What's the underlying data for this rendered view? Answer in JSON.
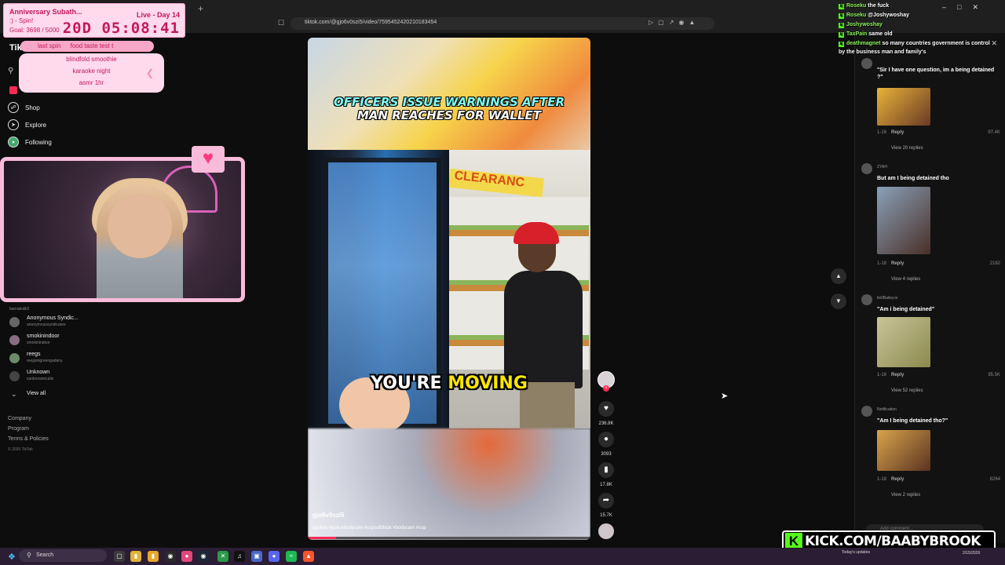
{
  "browser": {
    "url": "tiktok.com/@gjo6v0szi5/video/7595452420210183454",
    "new_tab": "+"
  },
  "subathon": {
    "title": "Anniversary Subath...",
    "status": "Live - Day 14",
    "spin": ":) - Spin!",
    "goal": "Goal: 3698 / 5000",
    "timer": "20D 05:08:41"
  },
  "spin_wheel": {
    "current": "last spin",
    "current_value": "food taste test t",
    "items": [
      "blindfold smoothie",
      "karaoke night",
      "asmr 1hr"
    ]
  },
  "tiktok": {
    "logo": "TikTok",
    "nav": [
      {
        "label": "Shop",
        "icon": "shop-icon"
      },
      {
        "label": "Explore",
        "icon": "compass-icon"
      },
      {
        "label": "Following",
        "icon": "following-icon"
      }
    ],
    "following": [
      {
        "name": "",
        "handle": "bamabolili2"
      },
      {
        "name": "Anonymous Syndic...",
        "handle": "anonymoussyndicatee"
      },
      {
        "name": "smokinindoor",
        "handle": "smokinindoor"
      },
      {
        "name": "reegs",
        "handle": "reegsingreengadany"
      },
      {
        "name": "Unknown",
        "handle": "xunknownrcalix"
      }
    ],
    "view_all": "View all",
    "footer": [
      "Company",
      "Program",
      "Terms & Policies"
    ],
    "copyright": "© 2026 TikTok"
  },
  "video": {
    "headline_line1": "OFFICERS ISSUE WARNINGS AFTER",
    "headline_line2": "MAN REACHES FOR WALLET",
    "sign_text": "CLEARANC",
    "subtitle_white": "YOU'RE",
    "subtitle_yellow": "MOVING",
    "author": "gjo6v0szi5",
    "hashtags": "#police #policebodycam #copsoftiktok #bodycam #cop",
    "progress": 0.1
  },
  "actions": {
    "likes": "236.8K",
    "comments": "3093",
    "saves": "17.8K",
    "shares": "15.7K",
    "plus": "+"
  },
  "comments": [
    {
      "user": "",
      "text": "\"Sir I have one question, im a being detained ?\"",
      "time": "1-16",
      "reply": "Reply",
      "likes": "97.4K",
      "view": "View 20 replies",
      "img_colors": [
        "#e8b339",
        "#6a3a24"
      ]
    },
    {
      "user": "ZYAH",
      "text": "But am I being detained tho",
      "time": "1-18",
      "reply": "Reply",
      "likes": "2182",
      "view": "View 4 replies",
      "img_colors": [
        "#8aa0b8",
        "#4a3028"
      ]
    },
    {
      "user": "its0Bailey.ie",
      "text": "\"Am i being detained\"",
      "time": "1-16",
      "reply": "Reply",
      "likes": "95.5K",
      "view": "View 52 replies",
      "img_colors": [
        "#c9c49a",
        "#8b8a4d"
      ]
    },
    {
      "user": "Notification",
      "text": "\"Am I being detained tho?\"",
      "time": "1-18",
      "reply": "Reply",
      "likes": "8264",
      "view": "View 2 replies",
      "img_colors": [
        "#d9a44c",
        "#5a3320"
      ]
    }
  ],
  "comment_input": "Add comment...",
  "chat": [
    {
      "user": "Roseku",
      "msg": "the fuck"
    },
    {
      "user": "Roseku",
      "msg": "@Joshywoshay"
    },
    {
      "user": "Joshywoshay",
      "msg": ""
    },
    {
      "user": "TaxPain",
      "msg": "same old"
    },
    {
      "user": "deathmagnet",
      "msg": "so many countries government is control by the business man and family's"
    }
  ],
  "kick": {
    "logo_letter": "K",
    "url": "KICK.COM/BAABYBROOK"
  },
  "taskbar": {
    "search": "Search",
    "tray_text": "Today's updates",
    "time": "",
    "date": "2/15/2026"
  },
  "colors": {
    "tiktok_red": "#fe2c55",
    "kick_green": "#53fc18",
    "overlay_pink": "#ffd9ec",
    "overlay_text": "#c2185b"
  }
}
